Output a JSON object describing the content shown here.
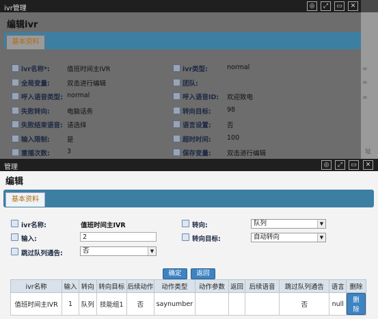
{
  "bg": {
    "title": "ivr管理",
    "heading": "编辑ivr",
    "tab": "基本资料",
    "rows": [
      {
        "l1": "ivr名称*:",
        "v1": "值班时间主IVR",
        "l2": "ivr类型:",
        "v2": "normal"
      },
      {
        "l1": "全局变量:",
        "v1": "双击进行编辑",
        "l2": "团队:",
        "v2": ""
      },
      {
        "l1": "呼入语音类型:",
        "v1": "normal",
        "l2": "呼入语音ID:",
        "v2": "欢迎致电"
      },
      {
        "l1": "失败转向:",
        "v1": "电脑话务",
        "l2": "转向目标:",
        "v2": "98"
      },
      {
        "l1": "失败结束语音:",
        "v1": "请选择",
        "l2": "语言设置:",
        "v2": "否"
      },
      {
        "l1": "输入限制:",
        "v1": "是",
        "l2": "超时时间:",
        "v2": "100"
      },
      {
        "l1": "重播次数:",
        "v1": "3",
        "l2": "保存变量:",
        "v2": "双击进行编辑"
      }
    ],
    "edge": {
      "a": "=",
      "b": "=",
      "c": "=",
      "d": "址"
    }
  },
  "fg": {
    "title": "管理",
    "heading": "编辑",
    "tab": "基本资料",
    "name_label": "ivr名称:",
    "name_value": "值班时间主IVR",
    "input_label": "输入:",
    "input_value": "2",
    "skip_label": "跳过队列通告:",
    "skip_value": "否",
    "turn_label": "转向:",
    "turn_value": "队列",
    "target_label": "转向目标:",
    "target_value": "自动转向",
    "ok": "确定",
    "back": "返回",
    "headers": [
      "ivr名称",
      "输入",
      "转向",
      "转向目标",
      "后续动作",
      "动作类型",
      "动作参数",
      "返回",
      "后续语音",
      "跳过队列通告",
      "语言",
      "删除"
    ],
    "row": [
      "值班时间主IVR",
      "1",
      "队列",
      "技能组1",
      "否",
      "saynumber",
      "",
      "",
      "",
      "否",
      "null"
    ],
    "del": "删除"
  }
}
